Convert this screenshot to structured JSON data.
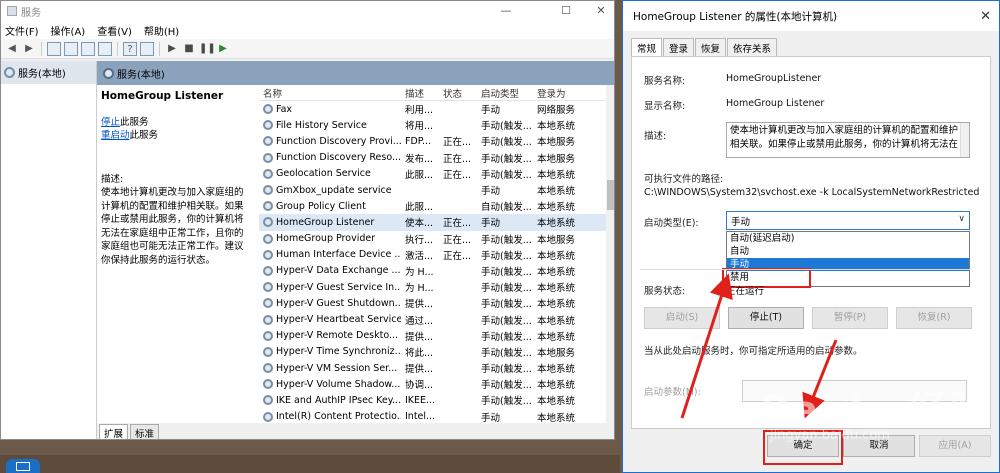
{
  "services_window": {
    "title": "服务",
    "menu": [
      "文件(F)",
      "操作(A)",
      "查看(V)",
      "帮助(H)"
    ],
    "tree_item": "服务(本地)",
    "panel_title": "服务(本地)",
    "selected_service": "HomeGroup Listener",
    "stop_link": "停止",
    "stop_suffix": "此服务",
    "restart_link": "重启动",
    "restart_suffix": "此服务",
    "desc_label": "描述:",
    "desc_text": "使本地计算机更改与加入家庭组的计算机的配置和维护相关联。如果停止或禁用此服务，你的计算机将无法在家庭组中正常工作，且你的家庭组也可能无法正常工作。建议你保持此服务的运行状态。",
    "columns": [
      "名称",
      "描述",
      "状态",
      "启动类型",
      "登录为"
    ],
    "rows": [
      [
        "Fax",
        "利用...",
        "",
        "手动",
        "网络服务"
      ],
      [
        "File History Service",
        "将用...",
        "",
        "手动(触发...",
        "本地系统"
      ],
      [
        "Function Discovery Provi...",
        "FDP...",
        "正在...",
        "手动(触发...",
        "本地服务"
      ],
      [
        "Function Discovery Reso...",
        "发布...",
        "正在...",
        "手动(触发...",
        "本地服务"
      ],
      [
        "Geolocation Service",
        "此服...",
        "正在...",
        "手动(触发...",
        "本地系统"
      ],
      [
        "GmXbox_update service",
        "",
        "",
        "手动",
        "本地系统"
      ],
      [
        "Group Policy Client",
        "此服...",
        "",
        "自动(触发...",
        "本地系统"
      ],
      [
        "HomeGroup Listener",
        "使本...",
        "正在...",
        "手动",
        "本地系统"
      ],
      [
        "HomeGroup Provider",
        "执行...",
        "正在...",
        "手动(触发...",
        "本地服务"
      ],
      [
        "Human Interface Device ...",
        "激活...",
        "正在...",
        "手动(触发...",
        "本地系统"
      ],
      [
        "Hyper-V Data Exchange ...",
        "为 H...",
        "",
        "手动(触发...",
        "本地系统"
      ],
      [
        "Hyper-V Guest Service In...",
        "为 H...",
        "",
        "手动(触发...",
        "本地系统"
      ],
      [
        "Hyper-V Guest Shutdown...",
        "提供...",
        "",
        "手动(触发...",
        "本地系统"
      ],
      [
        "Hyper-V Heartbeat Service",
        "通过...",
        "",
        "手动(触发...",
        "本地系统"
      ],
      [
        "Hyper-V Remote Deskto...",
        "提供...",
        "",
        "手动(触发...",
        "本地系统"
      ],
      [
        "Hyper-V Time Synchroniz...",
        "将此...",
        "",
        "手动(触发...",
        "本地服务"
      ],
      [
        "Hyper-V VM Session Ser...",
        "提供...",
        "",
        "手动(触发...",
        "本地系统"
      ],
      [
        "Hyper-V Volume Shadow...",
        "协调...",
        "",
        "手动(触发...",
        "本地系统"
      ],
      [
        "IKE and AuthIP IPsec Key...",
        "IKEE...",
        "",
        "手动(触发...",
        "本地系统"
      ],
      [
        "Intel(R) Content Protectio...",
        "Intel...",
        "",
        "手动",
        "本地系统"
      ]
    ],
    "bottom_tabs": [
      "扩展",
      "标准"
    ]
  },
  "dialog": {
    "title": "HomeGroup Listener 的属性(本地计算机)",
    "close_glyph": "✕",
    "tabs": [
      "常规",
      "登录",
      "恢复",
      "依存关系"
    ],
    "service_name_label": "服务名称:",
    "service_name": "HomeGroupListener",
    "display_name_label": "显示名称:",
    "display_name": "HomeGroup Listener",
    "description_label": "描述:",
    "description": "使本地计算机更改与加入家庭组的计算机的配置和维护相关联。如果停止或禁用此服务，你的计算机将无法在",
    "exe_path_label": "可执行文件的路径:",
    "exe_path": "C:\\WINDOWS\\System32\\svchost.exe -k LocalSystemNetworkRestricted",
    "startup_type_label": "启动类型(E):",
    "startup_type_value": "手动",
    "startup_options": [
      "自动(延迟启动)",
      "自动",
      "手动",
      "禁用"
    ],
    "highlighted_option": "手动",
    "service_status_label": "服务状态:",
    "service_status": "正在运行",
    "buttons": {
      "start": "启动(S)",
      "stop": "停止(T)",
      "pause": "暂停(P)",
      "resume": "恢复(R)"
    },
    "hint": "当从此处启动服务时，你可指定所适用的启动参数。",
    "start_params_label": "启动参数(M):",
    "ok": "确定",
    "cancel": "取消",
    "apply": "应用(A)"
  },
  "watermark": {
    "text": "Baidu 经验",
    "url": "jingyan.baidu.com"
  },
  "annotation_color": "#e0201a"
}
